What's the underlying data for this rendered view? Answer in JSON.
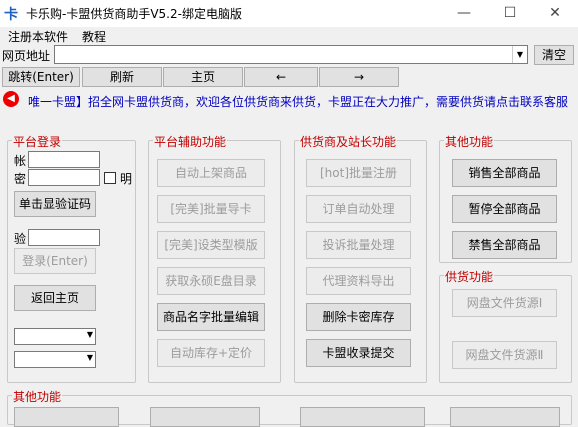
{
  "window": {
    "title": "卡乐购-卡盟供货商助手V5.2-绑定电脑版",
    "app_icon": "卡",
    "minimize": "—",
    "maximize": "☐",
    "close": "✕"
  },
  "menu": [
    "注册本软件",
    "教程"
  ],
  "address": {
    "label": "网页地址",
    "value": "",
    "clear": "清空"
  },
  "nav": {
    "jump": "跳转(Enter)",
    "refresh": "刷新",
    "home": "主页",
    "back": "←",
    "forward": "→"
  },
  "notice": "唯一卡盟】招全网卡盟供货商，欢迎各位供货商来供货，卡盟正在大力推广，需要供货请点击联系客服",
  "login": {
    "title": "平台登录",
    "account_label": "帐",
    "password_label": "密",
    "show_label": "明",
    "captcha_button": "单击显验证码",
    "captcha_label": "验",
    "login_button": "登录(Enter)",
    "return_button": "返回主页"
  },
  "assist": {
    "title": "平台辅助功能",
    "buttons": [
      "自动上架商品",
      "[完美]批量导卡",
      "[完美]设类型模版",
      "获取永硕E盘目录",
      "商品名字批量编辑",
      "自动库存+定价"
    ]
  },
  "supplier": {
    "title": "供货商及站长功能",
    "buttons": [
      "[hot]批量注册",
      "订单自动处理",
      "投诉批量处理",
      "代理资料导出",
      "删除卡密库存",
      "卡盟收录提交"
    ]
  },
  "other": {
    "title": "其他功能",
    "buttons": [
      "销售全部商品",
      "暂停全部商品",
      "禁售全部商品"
    ]
  },
  "supply": {
    "title": "供货功能",
    "buttons": [
      "网盘文件货源Ⅰ",
      "网盘文件货源Ⅱ"
    ]
  },
  "bottom": {
    "title": "其他功能"
  }
}
